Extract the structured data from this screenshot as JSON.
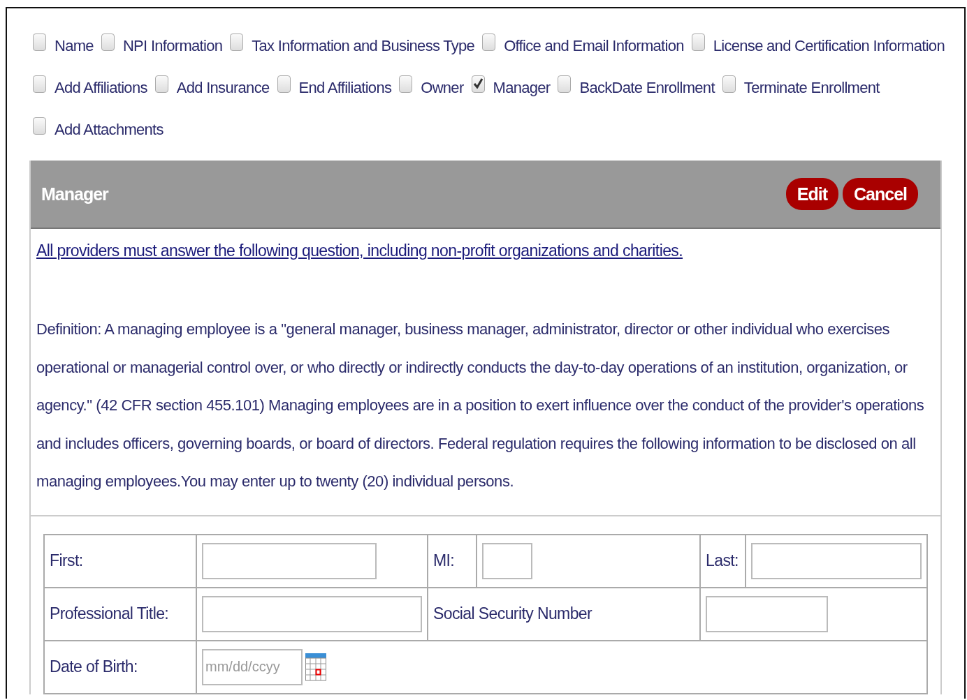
{
  "options": [
    {
      "label": "Name",
      "checked": false
    },
    {
      "label": "NPI Information",
      "checked": false
    },
    {
      "label": "Tax Information and Business Type",
      "checked": false
    },
    {
      "label": "Office and Email Information",
      "checked": false
    },
    {
      "label": "License and Certification Information",
      "checked": false
    },
    {
      "label": "Add Affiliations",
      "checked": false
    },
    {
      "label": "Add Insurance",
      "checked": false
    },
    {
      "label": "End Affiliations",
      "checked": false
    },
    {
      "label": "Owner",
      "checked": false
    },
    {
      "label": "Manager",
      "checked": true
    },
    {
      "label": "BackDate Enrollment",
      "checked": false
    },
    {
      "label": "Terminate Enrollment",
      "checked": false
    },
    {
      "label": "Add Attachments",
      "checked": false
    }
  ],
  "panel": {
    "title": "Manager",
    "buttons": [
      "Edit",
      "Cancel"
    ],
    "notice": "All providers must answer the following question, including non-profit organizations and charities.",
    "definition": "Definition: A managing employee is a \"general manager, business manager, administrator, director or other individual who exercises operational or managerial control over, or who directly or indirectly conducts the day-to-day operations of an institution, organization, or agency.\" (42 CFR section 455.101) Managing employees are in a position to exert influence over the conduct of the provider's operations and includes officers, governing boards, or board of directors. Federal regulation requires the following information to be disclosed on all managing employees.You may enter up to twenty (20) individual persons."
  },
  "form": {
    "rows": [
      [
        {
          "kind": "label",
          "text": "First:"
        },
        {
          "kind": "input"
        },
        {
          "kind": "label",
          "text": "MI:"
        },
        {
          "kind": "input"
        },
        {
          "kind": "label",
          "text": "Last:"
        },
        {
          "kind": "input"
        }
      ],
      [
        {
          "kind": "label",
          "text": "Professional Title:"
        },
        {
          "kind": "input"
        },
        {
          "kind": "label",
          "text": "Social Security Number",
          "colspan": 2
        },
        {
          "kind": "input",
          "colspan": 2
        }
      ],
      [
        {
          "kind": "label",
          "text": "Date of Birth:"
        },
        {
          "kind": "date",
          "placeholder": "mm/dd/ccyy",
          "colspan": 5
        }
      ]
    ]
  }
}
